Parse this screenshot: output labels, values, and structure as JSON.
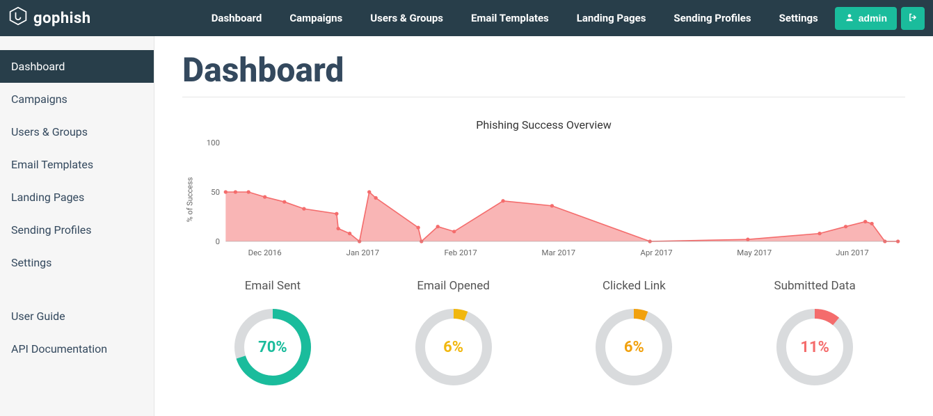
{
  "brand": "gophish",
  "nav": {
    "items": [
      "Dashboard",
      "Campaigns",
      "Users & Groups",
      "Email Templates",
      "Landing Pages",
      "Sending Profiles",
      "Settings"
    ],
    "admin_label": "admin"
  },
  "sidebar": {
    "items": [
      "Dashboard",
      "Campaigns",
      "Users & Groups",
      "Email Templates",
      "Landing Pages",
      "Sending Profiles",
      "Settings"
    ],
    "active_index": 0,
    "help_items": [
      "User Guide",
      "API Documentation"
    ]
  },
  "page": {
    "title": "Dashboard"
  },
  "chart_data": {
    "type": "area",
    "title": "Phishing Success Overview",
    "ylabel": "% of Success",
    "ylim": [
      0,
      100
    ],
    "yticks": [
      0,
      50,
      100
    ],
    "x_tick_labels": [
      "Dec 2016",
      "Jan 2017",
      "Feb 2017",
      "Mar 2017",
      "Apr 2017",
      "May 2017",
      "Jun 2017"
    ],
    "x": [
      0,
      3,
      7,
      12,
      18,
      24,
      34,
      34.5,
      38,
      41,
      44,
      46,
      59,
      60,
      65,
      70,
      85,
      100,
      130,
      160,
      182,
      190,
      196,
      198,
      202,
      206
    ],
    "y": [
      50,
      50,
      50,
      45,
      40,
      33,
      28,
      13,
      8,
      0,
      50,
      44,
      14,
      0,
      15,
      10,
      41,
      36,
      0,
      2,
      8,
      15,
      20,
      18,
      0,
      0
    ],
    "x_tick_positions": [
      12,
      42,
      72,
      102,
      132,
      162,
      192
    ]
  },
  "donuts": [
    {
      "label": "Email Sent",
      "value": 70,
      "display": "70%",
      "color": "#1abc9c"
    },
    {
      "label": "Email Opened",
      "value": 6,
      "display": "6%",
      "color": "#f1b70e"
    },
    {
      "label": "Clicked Link",
      "value": 6,
      "display": "6%",
      "color": "#f1a10e"
    },
    {
      "label": "Submitted Data",
      "value": 11,
      "display": "11%",
      "color": "#f46c6c"
    }
  ]
}
